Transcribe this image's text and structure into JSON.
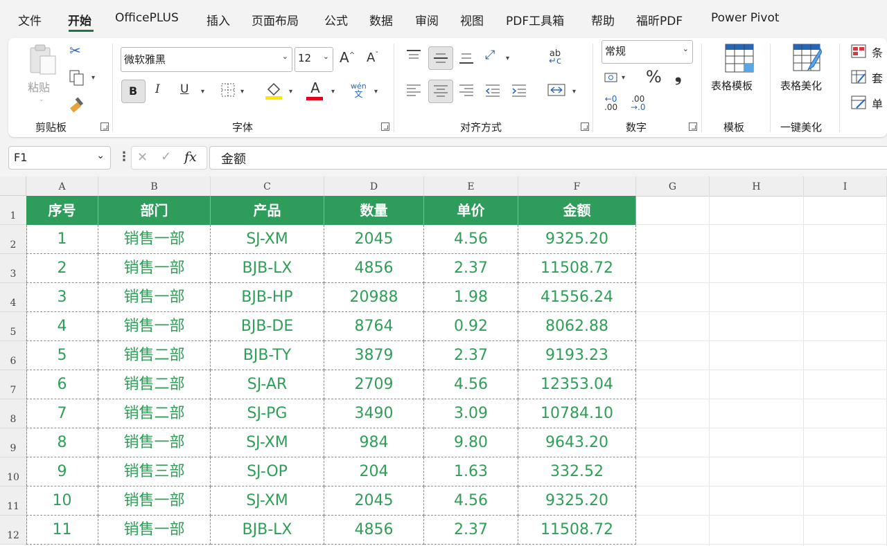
{
  "menu": {
    "tabs": [
      "文件",
      "开始",
      "OfficePLUS",
      "插入",
      "页面布局",
      "公式",
      "数据",
      "审阅",
      "视图",
      "PDF工具箱",
      "帮助",
      "福昕PDF",
      "Power Pivot"
    ],
    "active": "开始"
  },
  "ribbon": {
    "clipboard": {
      "paste_label": "粘贴",
      "group_label": "剪贴板"
    },
    "font": {
      "font_name": "微软雅黑",
      "font_size": "12",
      "group_label": "字体",
      "bold": "B",
      "italic": "I",
      "underline": "U",
      "font_color_letter": "A",
      "phonetic_top": "wén",
      "phonetic_bottom": "文",
      "grow": "A",
      "shrink": "A"
    },
    "alignment": {
      "group_label": "对齐方式"
    },
    "number": {
      "format": "常规",
      "group_label": "数字",
      "percent": "%",
      "comma": "❟",
      "inc_decimal_top": "←0",
      "inc_decimal_bottom": ".00",
      "dec_decimal_top": ".00",
      "dec_decimal_bottom": "→.0"
    },
    "template": {
      "button_label": "表格模板",
      "group_label": "模板"
    },
    "beautify": {
      "button_label": "表格美化",
      "group_label": "一键美化"
    },
    "styles": {
      "items": [
        "条",
        "套",
        "单"
      ]
    },
    "colors": {
      "highlight_underline": "#ffe600",
      "font_color_underline": "#e3001b"
    }
  },
  "formula_bar": {
    "name_box": "F1",
    "fx": "fx",
    "content": "金额"
  },
  "sheet": {
    "columns": [
      "A",
      "B",
      "C",
      "D",
      "E",
      "F",
      "G",
      "H",
      "I"
    ],
    "rows": [
      "1",
      "2",
      "3",
      "4",
      "5",
      "6",
      "7",
      "8",
      "9",
      "10",
      "11",
      "12"
    ],
    "header": [
      "序号",
      "部门",
      "产品",
      "数量",
      "单价",
      "金额"
    ],
    "data": [
      [
        "1",
        "销售一部",
        "SJ-XM",
        "2045",
        "4.56",
        "9325.20"
      ],
      [
        "2",
        "销售一部",
        "BJB-LX",
        "4856",
        "2.37",
        "11508.72"
      ],
      [
        "3",
        "销售一部",
        "BJB-HP",
        "20988",
        "1.98",
        "41556.24"
      ],
      [
        "4",
        "销售一部",
        "BJB-DE",
        "8764",
        "0.92",
        "8062.88"
      ],
      [
        "5",
        "销售二部",
        "BJB-TY",
        "3879",
        "2.37",
        "9193.23"
      ],
      [
        "6",
        "销售二部",
        "SJ-AR",
        "2709",
        "4.56",
        "12353.04"
      ],
      [
        "7",
        "销售二部",
        "SJ-PG",
        "3490",
        "3.09",
        "10784.10"
      ],
      [
        "8",
        "销售一部",
        "SJ-XM",
        "984",
        "9.80",
        "9643.20"
      ],
      [
        "9",
        "销售三部",
        "SJ-OP",
        "204",
        "1.63",
        "332.52"
      ],
      [
        "10",
        "销售一部",
        "SJ-XM",
        "2045",
        "4.56",
        "9325.20"
      ],
      [
        "11",
        "销售一部",
        "BJB-LX",
        "4856",
        "2.37",
        "11508.72"
      ]
    ],
    "header_color": "#2e9c5b",
    "text_color": "#2f9e57"
  }
}
